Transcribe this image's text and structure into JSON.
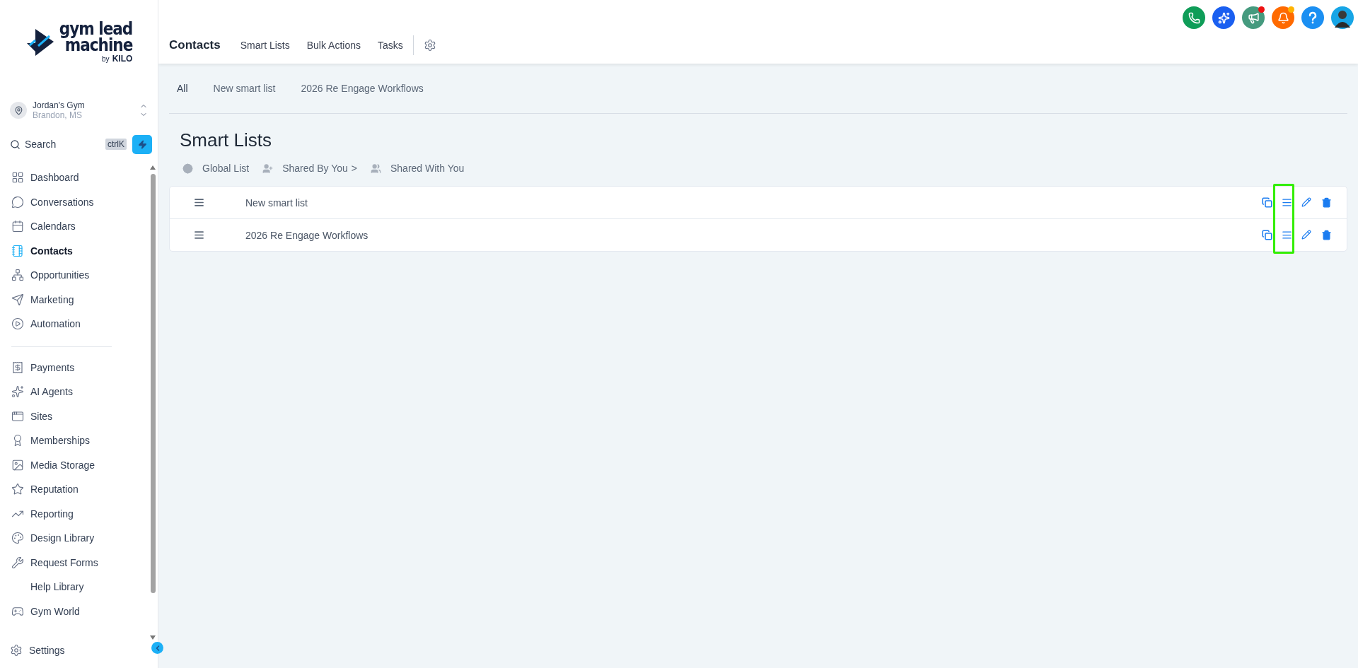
{
  "logo": {
    "line1": "gym lead",
    "line2": "machine",
    "by": "by",
    "brand": "KILO"
  },
  "location": {
    "name": "Jordan's Gym",
    "place": "Brandon, MS"
  },
  "search": {
    "label": "Search",
    "shortcut": "ctrlK"
  },
  "sidebar": {
    "items": [
      {
        "label": "Dashboard",
        "selected": false
      },
      {
        "label": "Conversations",
        "selected": false
      },
      {
        "label": "Calendars",
        "selected": false
      },
      {
        "label": "Contacts",
        "selected": true
      },
      {
        "label": "Opportunities",
        "selected": false
      },
      {
        "label": "Marketing",
        "selected": false
      },
      {
        "label": "Automation",
        "selected": false
      },
      {
        "label": "Payments",
        "selected": false
      },
      {
        "label": "AI Agents",
        "selected": false
      },
      {
        "label": "Sites",
        "selected": false
      },
      {
        "label": "Memberships",
        "selected": false
      },
      {
        "label": "Media Storage",
        "selected": false
      },
      {
        "label": "Reputation",
        "selected": false
      },
      {
        "label": "Reporting",
        "selected": false
      },
      {
        "label": "Design Library",
        "selected": false
      },
      {
        "label": "Request Forms",
        "selected": false
      },
      {
        "label": "Help Library",
        "selected": false
      },
      {
        "label": "Gym World",
        "selected": false
      }
    ],
    "settings": "Settings"
  },
  "top_icons": [
    {
      "color": "#0f9d58"
    },
    {
      "color": "#1a5ff0"
    },
    {
      "color": "#459a7e",
      "badge": {
        "color": "#ee1111"
      }
    },
    {
      "color": "#ff6a00",
      "badge": {
        "color": "#ffb300"
      }
    },
    {
      "color": "#1b8ff2"
    },
    {
      "color": "#16a5e6",
      "kind": "avatar"
    }
  ],
  "header_tabs": [
    {
      "label": "Contacts",
      "selected": true
    },
    {
      "label": "Smart Lists",
      "selected": false
    },
    {
      "label": "Bulk Actions",
      "selected": false
    },
    {
      "label": "Tasks",
      "selected": false
    }
  ],
  "list_tabs": [
    {
      "label": "All",
      "selected": true
    },
    {
      "label": "New smart list",
      "selected": false
    },
    {
      "label": "2026 Re Engage Workflows",
      "selected": false
    }
  ],
  "title": "Smart Lists",
  "filters": [
    {
      "label": "Global List"
    },
    {
      "label": "Shared By You",
      "suffix": ">"
    },
    {
      "label": "Shared With You"
    }
  ],
  "rows": [
    {
      "name": "New smart list"
    },
    {
      "name": "2026 Re Engage Workflows"
    }
  ],
  "highlight_box": true
}
